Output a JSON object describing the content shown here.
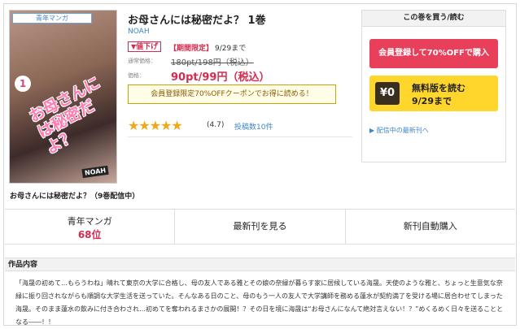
{
  "cover": {
    "genre_tag": "青年マンガ",
    "volume_mark": "1",
    "cover_title": "お母さんには秘密だよ？",
    "cover_author": "NOAH"
  },
  "book": {
    "title": "お母さんには秘密だよ？ 1巻",
    "author": "NOAH",
    "sale_badge": "値下げ",
    "limited_label": "【期間限定】",
    "limited_date": "9/29まで",
    "normal_price_label": "通常価格：",
    "old_price": "180pt/198円（税込）",
    "price_label": "価格：",
    "new_price": "90pt/99円（税込）",
    "coupon_text": "会員登録限定70%OFFクーポンでお得に読める！",
    "rating": "(4.7)",
    "rating_value": 4.7,
    "reviews_link": "投稿数10件"
  },
  "buybox": {
    "heading": "この巻を買う/読む",
    "member_button": "会員登録して70%OFFで購入",
    "free_icon": "¥0",
    "free_line1": "無料版を読む",
    "free_line2": "9/29まで",
    "latest_link": "▶ 配信中の最新刊へ"
  },
  "caption": "お母さんには秘密だよ？（9巻配信中）",
  "tabs": {
    "genre": "青年マンガ",
    "rank": "68位",
    "latest": "最新刊を見る",
    "auto": "新刊自動購入"
  },
  "section": {
    "heading": "作品内容",
    "synopsis": "「海晟の初めて…もらうわね」晴れて東京の大学に合格し、母の友人である雅とその娘の奈緑が暮らす家に居候している海晟。天使のような雅と、ちょっと生意気な奈緑に振り回されながらも順調な大学生活を送っていた。そんなある日のこと、母のもう一人の友人で大学講師を務める蓮水が契約満了を受ける場に居合わせてしまった海晟。そのまま蓮水の飲みに付き合わされ…初めてを奪われるまさかの展開！？その日を境に海晟は“お母さんになんて絶対言えない！？”めくるめく日々を送ることとなる――！！"
  },
  "colors": {
    "accent_red": "#d52b50",
    "link_blue": "#3f86c7",
    "member_button": "#e8405b",
    "free_button": "#ffd62b",
    "star": "#f0a818"
  }
}
